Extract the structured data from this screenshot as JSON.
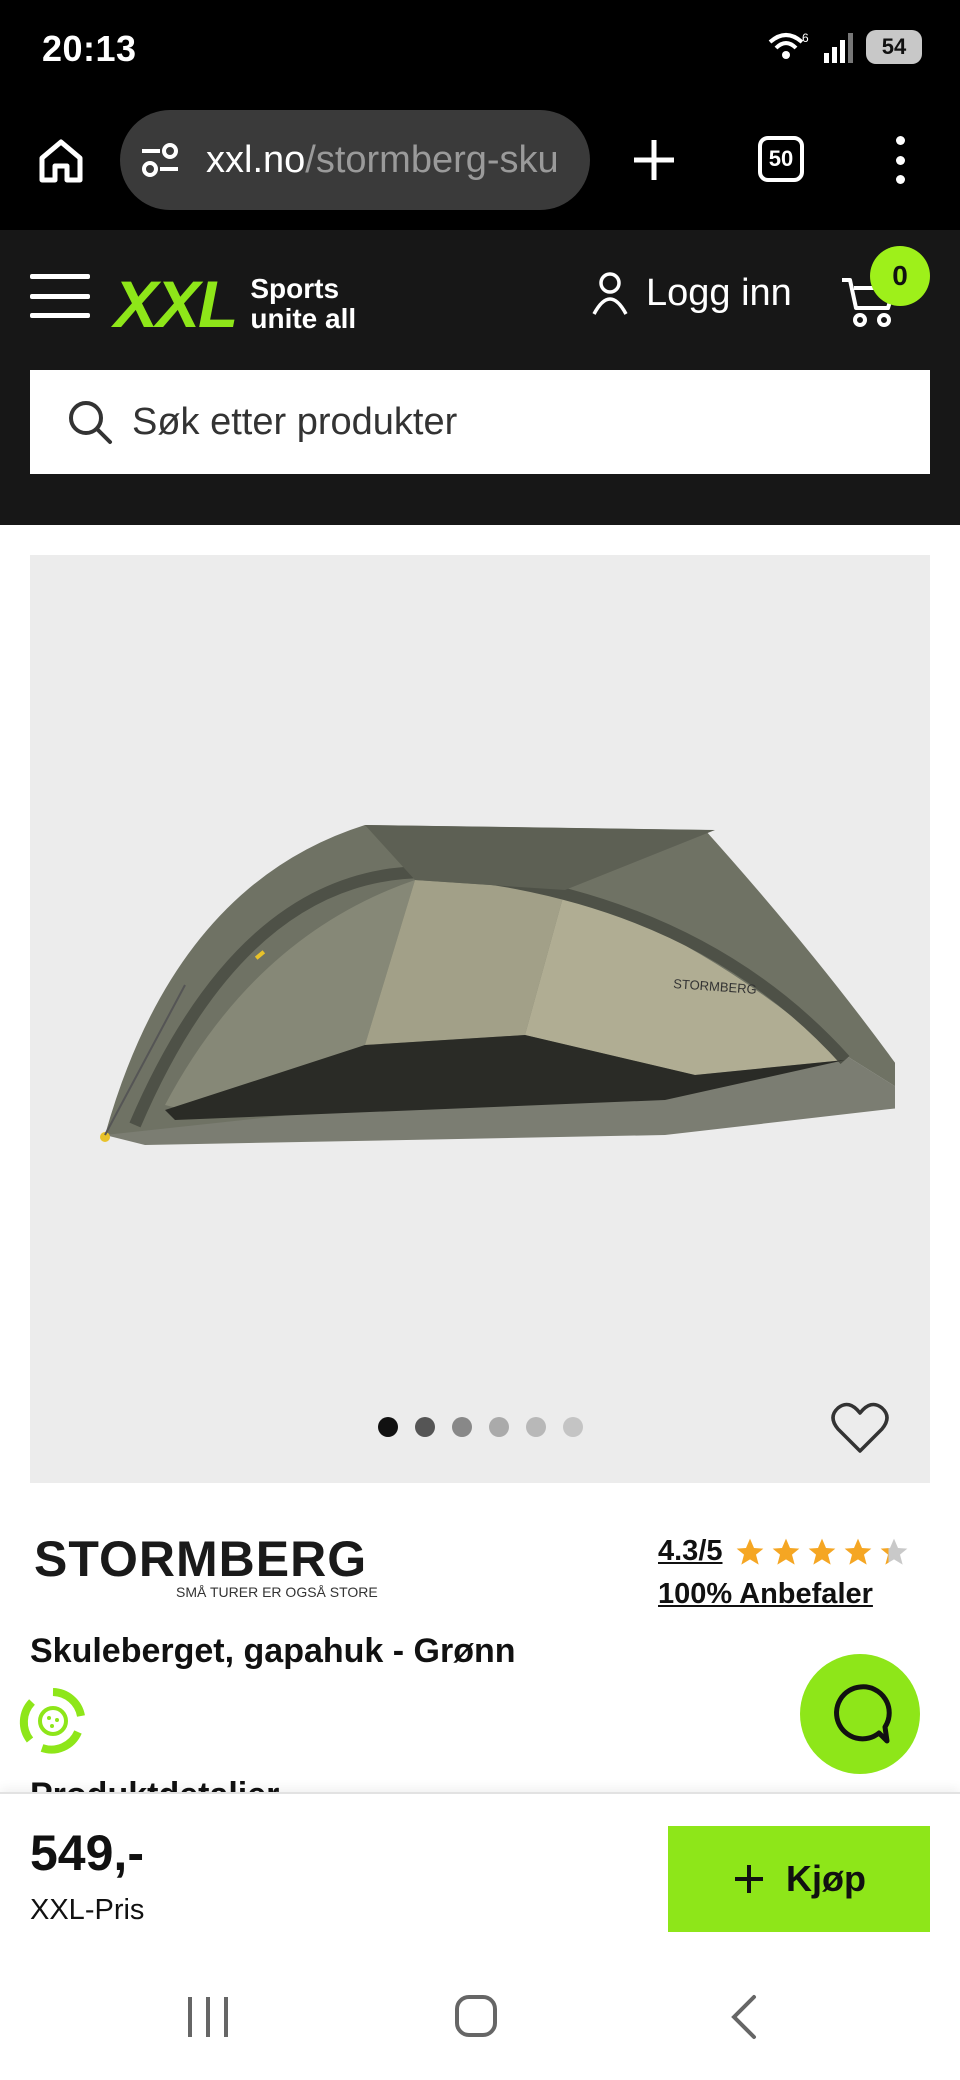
{
  "status_bar": {
    "time": "20:13",
    "wifi_label": "6",
    "battery": "54"
  },
  "browser": {
    "url_domain": "xxl.no",
    "url_path": "/stormberg-sku",
    "tab_count": "50"
  },
  "header": {
    "logo_text": "XXL",
    "logo_tagline_line1": "Sports",
    "logo_tagline_line2": "unite all",
    "login_label": "Logg inn",
    "cart_count": "0",
    "search_placeholder": "Søk etter produkter"
  },
  "gallery": {
    "image_count": 6,
    "active_index": 0
  },
  "product": {
    "brand_name": "STORMBERG",
    "brand_tagline": "SMÅ TURER ER OGSÅ STORE",
    "rating_text": "4.3/5",
    "rating_value": 4.3,
    "recommend_text": "100% Anbefaler",
    "title": "Skuleberget, gapahuk - Grønn",
    "next_section_heading": "Produktdetaljer"
  },
  "buy_bar": {
    "price": "549,-",
    "price_label": "XXL-Pris",
    "buy_label": "Kjøp"
  },
  "colors": {
    "accent": "#8ee619",
    "header_bg": "#171717",
    "star": "#f5a623"
  }
}
